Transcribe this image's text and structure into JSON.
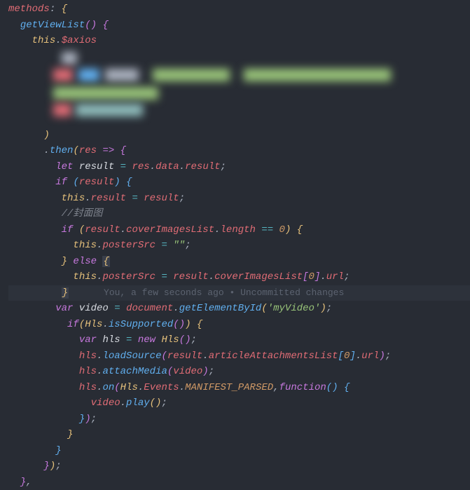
{
  "code": {
    "l1": {
      "methods": "methods",
      "colon": ": ",
      "brace": "{"
    },
    "l2": {
      "indent": "  ",
      "name": "getViewList",
      "paren": "() ",
      "brace": "{"
    },
    "l3": {
      "indent": "    ",
      "this": "this",
      "dot": ".",
      "prop": "$axios"
    },
    "l6": {
      "indent": "      ",
      "paren": ")"
    },
    "l7": {
      "indent": "      ",
      "dot": ".",
      "fn": "then",
      "open": "(",
      "param": "res",
      "arrow": " => ",
      "brace": "{"
    },
    "l8": {
      "indent": "        ",
      "let": "let ",
      "var": "result",
      "eq": " = ",
      "res": "res",
      "d1": ".",
      "data": "data",
      "d2": ".",
      "result": "result",
      "semi": ";"
    },
    "l9": {
      "indent": "        ",
      "if": "if ",
      "open": "(",
      "var": "result",
      "close": ") ",
      "brace": "{"
    },
    "l10": {
      "indent": "         ",
      "this": "this",
      "d": ".",
      "prop": "result",
      "eq": " = ",
      "var": "result",
      "semi": ";"
    },
    "l11": {
      "indent": "         ",
      "cmt": "//封面图"
    },
    "l12": {
      "indent": "         ",
      "if": "if ",
      "open": "(",
      "var": "result",
      "d1": ".",
      "p1": "coverImagesList",
      "d2": ".",
      "p2": "length",
      "eq": " == ",
      "num": "0",
      "close": ") ",
      "brace": "{"
    },
    "l13": {
      "indent": "           ",
      "this": "this",
      "d": ".",
      "prop": "posterSrc",
      "eq": " = ",
      "str": "\"\"",
      "semi": ";"
    },
    "l14": {
      "indent": "         ",
      "close": "}",
      "else": " else ",
      "open": "{"
    },
    "l15": {
      "indent": "           ",
      "this": "this",
      "d": ".",
      "prop": "posterSrc",
      "eq": " = ",
      "var": "result",
      "d2": ".",
      "p1": "coverImagesList",
      "bo": "[",
      "num": "0",
      "bc": "]",
      "d3": ".",
      "p2": "url",
      "semi": ";"
    },
    "l16": {
      "indent": "         ",
      "close": "}"
    },
    "l17": {
      "indent": "        ",
      "var": "var ",
      "name": "video",
      "eq": " = ",
      "doc": "document",
      "d": ".",
      "fn": "getElementById",
      "open": "(",
      "str": "'myVideo'",
      "close": ")",
      "semi": ";"
    },
    "l18": {
      "indent": "          ",
      "if": "if",
      "open": "(",
      "cls": "Hls",
      "d": ".",
      "fn": "isSupported",
      "paren": "()",
      ")": ") ",
      "brace": "{"
    },
    "l19": {
      "indent": "            ",
      "var": "var ",
      "name": "hls",
      "eq": " = ",
      "new": "new ",
      "cls": "Hls",
      "paren": "()",
      "semi": ";"
    },
    "l20": {
      "indent": "            ",
      "obj": "hls",
      "d": ".",
      "fn": "loadSource",
      "open": "(",
      "var": "result",
      "d2": ".",
      "p1": "articleAttachmentsList",
      "bo": "[",
      "num": "0",
      "bc": "]",
      "d3": ".",
      "p2": "url",
      "close": ")",
      "semi": ";"
    },
    "l21": {
      "indent": "            ",
      "obj": "hls",
      "d": ".",
      "fn": "attachMedia",
      "open": "(",
      "var": "video",
      "close": ")",
      "semi": ";"
    },
    "l22": {
      "indent": "            ",
      "obj": "hls",
      "d": ".",
      "fn": "on",
      "open": "(",
      "cls": "Hls",
      "d2": ".",
      "p1": "Events",
      "d3": ".",
      "p2": "MANIFEST_PARSED",
      "comma": ",",
      "func": "function",
      "paren": "() ",
      "brace": "{"
    },
    "l23": {
      "indent": "              ",
      "obj": "video",
      "d": ".",
      "fn": "play",
      "paren": "()",
      "semi": ";"
    },
    "l24": {
      "indent": "            ",
      "close": "}",
      ")": ")",
      "semi": ";"
    },
    "l25": {
      "indent": "          ",
      "close": "}"
    },
    "l26": {
      "indent": "        ",
      "close": "}"
    },
    "l27": {
      "indent": "      ",
      "close": "}",
      ")": ")",
      "semi": ";"
    },
    "l28": {
      "indent": "  ",
      "close": "}",
      "comma": ","
    }
  },
  "blame": "You, a few seconds ago • Uncommitted changes"
}
